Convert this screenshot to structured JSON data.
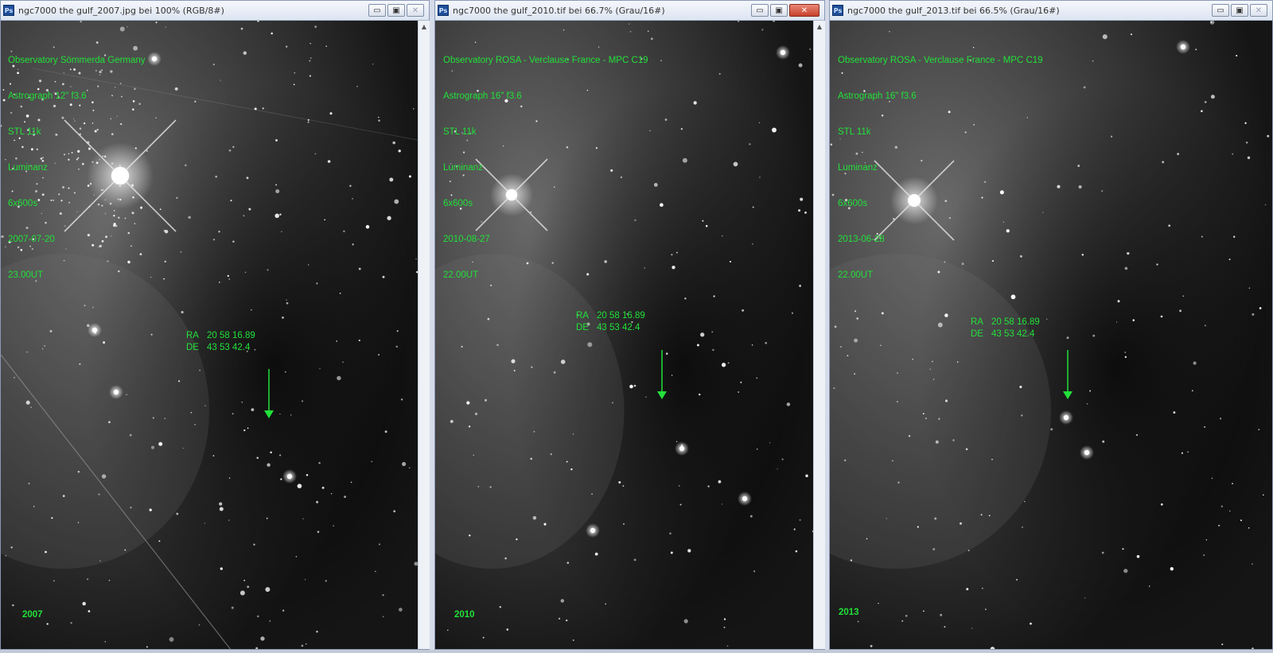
{
  "windows": [
    {
      "title": "ngc7000 the gulf_2007.jpg bei 100% (RGB/8#)",
      "info_lines": [
        "Observatory Sömmerda Germany",
        "Astrograph 12\" f3.6",
        "STL 11k",
        "Luminanz",
        "6x600s",
        "2007-07-20",
        "23.00UT"
      ],
      "ra_label": "RA",
      "ra_value": "20 58 16.89",
      "de_label": "DE",
      "de_value": "43 53 42.4",
      "year": "2007",
      "close_active": false
    },
    {
      "title": "ngc7000 the gulf_2010.tif bei 66.7% (Grau/16#)",
      "info_lines": [
        "Observatory ROSA - Verclause France - MPC C19",
        "Astrograph 16\" f3.6",
        "STL 11k",
        "Luminanz",
        "6x600s",
        "2010-08-27",
        "22.00UT"
      ],
      "ra_label": "RA",
      "ra_value": "20 58 16.89",
      "de_label": "DE",
      "de_value": "43 53 42.4",
      "year": "2010",
      "close_active": true
    },
    {
      "title": "ngc7000 the gulf_2013.tif bei 66.5% (Grau/16#)",
      "info_lines": [
        "Observatory ROSA - Verclause France - MPC C19",
        "Astrograph 16\" f3.6",
        "STL 11k",
        "Luminanz",
        "6x600s",
        "2013-06-28",
        "22.00UT"
      ],
      "ra_label": "RA",
      "ra_value": "20 58 16.89",
      "de_label": "DE",
      "de_value": "43 53 42.4",
      "year": "2013",
      "close_active": false
    }
  ],
  "colors": {
    "annotation_green": "#22e03a"
  },
  "icons": {
    "app_icon": "photoshop-ps-icon",
    "minimize": "minimize-icon",
    "restore": "restore-icon",
    "close": "close-icon"
  }
}
